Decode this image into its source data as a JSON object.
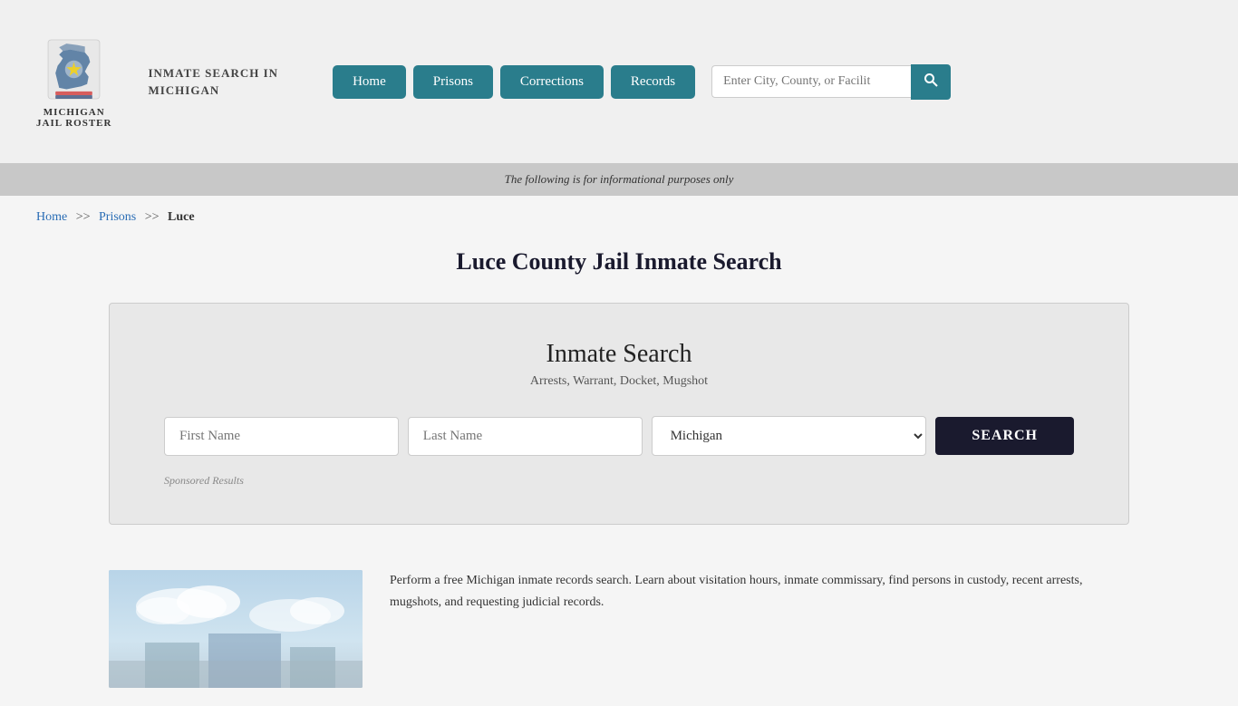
{
  "header": {
    "logo_line1": "MICHIGAN",
    "logo_line2": "JAIL ROSTER",
    "site_title_line1": "INMATE SEARCH IN",
    "site_title_line2": "MICHIGAN",
    "nav": {
      "home": "Home",
      "prisons": "Prisons",
      "corrections": "Corrections",
      "records": "Records"
    },
    "search_placeholder": "Enter City, County, or Facilit"
  },
  "info_bar": {
    "text": "The following is for informational purposes only"
  },
  "breadcrumb": {
    "home": "Home",
    "separator1": ">>",
    "prisons": "Prisons",
    "separator2": ">>",
    "current": "Luce"
  },
  "main": {
    "page_title": "Luce County Jail Inmate Search",
    "search_box": {
      "title": "Inmate Search",
      "subtitle": "Arrests, Warrant, Docket, Mugshot",
      "first_name_placeholder": "First Name",
      "last_name_placeholder": "Last Name",
      "state_default": "Michigan",
      "search_button": "SEARCH",
      "sponsored_label": "Sponsored Results"
    }
  },
  "bottom": {
    "description": "Perform a free Michigan inmate records search. Learn about visitation hours, inmate commissary, find persons in custody, recent arrests, mugshots, and requesting judicial records."
  }
}
